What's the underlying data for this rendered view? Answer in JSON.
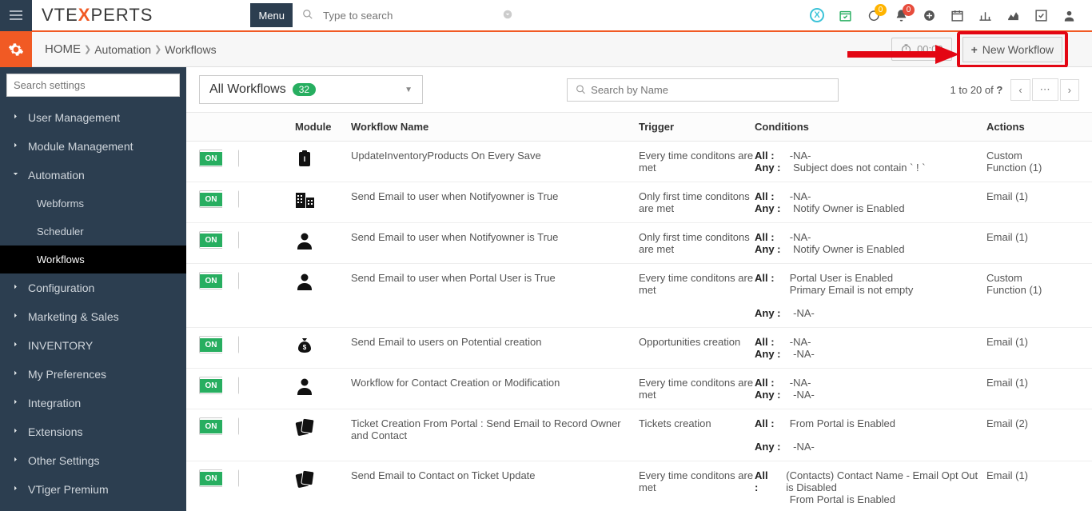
{
  "topbar": {
    "logo_prefix": "VTE",
    "logo_x": "X",
    "logo_suffix": "PERTS",
    "menu_label": "Menu",
    "search_placeholder": "Type to search",
    "chat_badge": "0",
    "bell_badge": "0"
  },
  "breadcrumb": {
    "home": "HOME",
    "part1": "Automation",
    "part2": "Workflows",
    "timer": "00:00",
    "new_workflow_label": "New Workflow"
  },
  "sidebar": {
    "search_placeholder": "Search settings",
    "items": [
      {
        "label": "User Management",
        "chev": ">"
      },
      {
        "label": "Module Management",
        "chev": ">"
      },
      {
        "label": "Automation",
        "chev": "v",
        "expanded": true
      },
      {
        "label": "Configuration",
        "chev": ">"
      },
      {
        "label": "Marketing & Sales",
        "chev": ">"
      },
      {
        "label": "INVENTORY",
        "chev": ">"
      },
      {
        "label": "My Preferences",
        "chev": ">"
      },
      {
        "label": "Integration",
        "chev": ">"
      },
      {
        "label": "Extensions",
        "chev": ">"
      },
      {
        "label": "Other Settings",
        "chev": ">"
      },
      {
        "label": "VTiger Premium",
        "chev": ">"
      }
    ],
    "subitems": [
      {
        "label": "Webforms"
      },
      {
        "label": "Scheduler"
      },
      {
        "label": "Workflows",
        "active": true
      }
    ]
  },
  "main": {
    "wf_select_label": "All Workflows",
    "wf_count": "32",
    "name_search_placeholder": "Search by Name",
    "pager_text": "1 to 20  of ",
    "pager_q": "?",
    "headers": {
      "module": "Module",
      "name": "Workflow Name",
      "trigger": "Trigger",
      "conditions": "Conditions",
      "actions": "Actions"
    },
    "rows": [
      {
        "on": "ON",
        "icon": "inventory",
        "name": "UpdateInventoryProducts On Every Save",
        "trigger": "Every time conditons are met",
        "cond_all": "-NA-",
        "cond_any": "Subject does not contain ` ! `",
        "action": "Custom Function (1)"
      },
      {
        "on": "ON",
        "icon": "building",
        "name": "Send Email to user when Notifyowner is True",
        "trigger": "Only first time conditons are met",
        "cond_all": "-NA-",
        "cond_any": "Notify Owner is Enabled",
        "action": "Email (1)"
      },
      {
        "on": "ON",
        "icon": "person",
        "name": "Send Email to user when Notifyowner is True",
        "trigger": "Only first time conditons are met",
        "cond_all": "-NA-",
        "cond_any": "Notify Owner is Enabled",
        "action": "Email (1)"
      },
      {
        "on": "ON",
        "icon": "person",
        "name": "Send Email to user when Portal User is True",
        "trigger": "Every time conditons are met",
        "cond_all": "Portal User is Enabled",
        "cond_all2": "Primary Email is not empty",
        "cond_any": "-NA-",
        "cond_any_spaced": true,
        "action": "Custom Function (1)"
      },
      {
        "on": "ON",
        "icon": "moneybag",
        "name": "Send Email to users on Potential creation",
        "trigger": "Opportunities creation",
        "cond_all": "-NA-",
        "cond_any": "-NA-",
        "action": "Email (1)"
      },
      {
        "on": "ON",
        "icon": "person",
        "name": "Workflow for Contact Creation or Modification",
        "trigger": "Every time conditons are met",
        "cond_all": "-NA-",
        "cond_any": "-NA-",
        "action": "Email (1)"
      },
      {
        "on": "ON",
        "icon": "ticket",
        "name": "Ticket Creation From Portal : Send Email to Record Owner and Contact",
        "trigger": "Tickets creation",
        "cond_all": "From Portal is Enabled",
        "cond_any": "-NA-",
        "cond_any_spaced": true,
        "action": "Email (2)"
      },
      {
        "on": "ON",
        "icon": "ticket",
        "name": "Send Email to Contact on Ticket Update",
        "trigger": "Every time conditons are met",
        "cond_all": "(Contacts) Contact Name - Email Opt Out is Disabled",
        "cond_all2": "From Portal is Enabled",
        "action": "Email (1)"
      }
    ],
    "labels": {
      "all": "All :",
      "any": "Any :"
    }
  }
}
